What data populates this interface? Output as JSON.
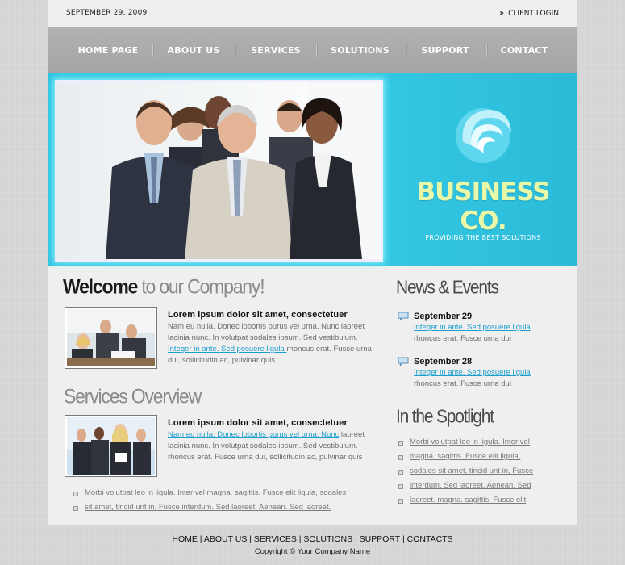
{
  "header": {
    "date": "SEPTEMBER 29, 2009",
    "client_login": "CLIENT LOGIN"
  },
  "nav": [
    "HOME PAGE",
    "ABOUT US",
    "SERVICES",
    "SOLUTIONS",
    "SUPPORT",
    "CONTACT"
  ],
  "brand": {
    "name": "BUSINESS CO.",
    "tagline": "PROVIDING THE BEST SOLUTIONS"
  },
  "welcome": {
    "title_bold": "Welcome",
    "title_rest": " to our Company!",
    "heading": "Lorem ipsum dolor sit amet, consectetuer",
    "text_a": "Nam eu nulla. Donec lobortis purus vel urna. Nunc laoreet lacinia nunc. In volutpat sodales ipsum. Sed vestibulum.",
    "link": " Integer in ante. Sed posuere ligula ",
    "text_b": "rhoncus erat. Fusce urna dui, sollicitudin ac, pulvinar quis"
  },
  "services": {
    "title": "Services Overview",
    "heading": "Lorem ipsum dolor sit amet, consectetuer",
    "link": "Nam eu nulla. Donec lobortis purus vel urna. Nunc",
    "text": "laoreet lacinia nunc. In volutpat sodales ipsum. Sed vestibulum. rhoncus erat. Fusce urna dui, sollicitudin ac, pulvinar quis",
    "list": [
      "Morbi volutpat leo in ligula. Inter vel magna. sagittis. Fusce elit ligula, sodales",
      "sit amet, tincid unt in, Fusce interdum. Sed laoreet. Aenean. Sed laoreet."
    ]
  },
  "news": {
    "title": "News & Events",
    "items": [
      {
        "date": "September 29",
        "link": "Integer in ante. Sed posuere ligula",
        "text": "rhoncus erat. Fusce urna dui"
      },
      {
        "date": "September 28",
        "link": "Integer in ante. Sed posuere ligula",
        "text": "rhoncus erat. Fusce urna dui"
      }
    ]
  },
  "spotlight": {
    "title": "In the Spotlight",
    "items": [
      "Morbi volutpat leo in ligula. Inter vel",
      "magna. sagittis. Fusce elit ligula,",
      "sodales sit amet, tincid unt in, Fusce",
      "interdum. Sed laoreet. Aenean. Sed",
      "laoreet. magna. sagittis. Fusce elit "
    ]
  },
  "footer": {
    "links": [
      "HOME",
      "ABOUT US",
      "SERVICES",
      "SOLUTIONS",
      "SUPPORT",
      "CONTACTS"
    ],
    "separator": " | ",
    "copyright": "Copyright © Your Company Name"
  },
  "colors": {
    "accent": "#1b9fcf",
    "hero": "#34c8e4",
    "nav": "#aaaaaa",
    "brand_name": "#e9f7a8"
  }
}
